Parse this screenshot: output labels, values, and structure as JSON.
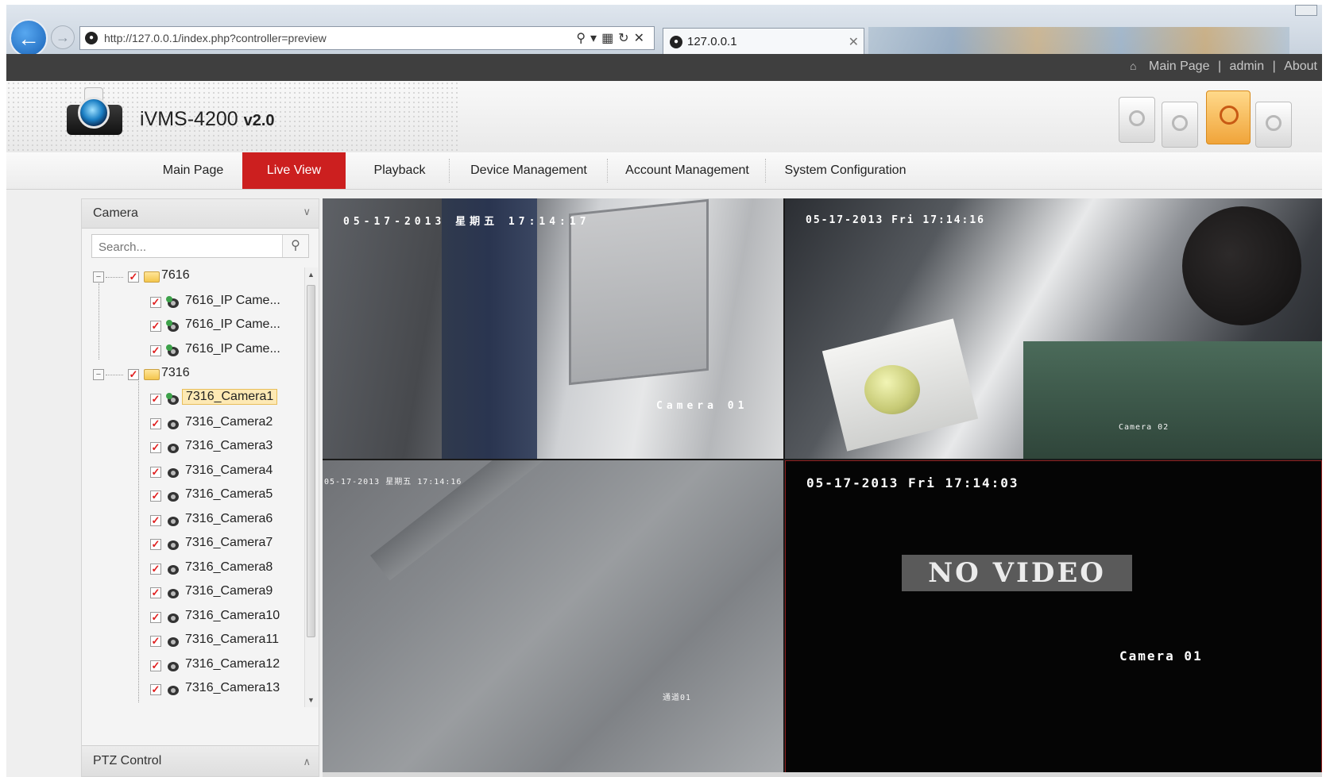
{
  "browser": {
    "url": "http://127.0.0.1/index.php?controller=preview",
    "url_host_prefix": "http://",
    "tab_title": "127.0.0.1"
  },
  "top_links": {
    "main_page": "Main Page",
    "sep1": "|",
    "user": "admin",
    "sep2": "|",
    "about": "About"
  },
  "app": {
    "name": "iVMS-4200",
    "version": "v2.0"
  },
  "nav": {
    "items": [
      "Main Page",
      "Live View",
      "Playback",
      "Device Management",
      "Account Management",
      "System Configuration"
    ],
    "active": "Live View"
  },
  "camera_panel": {
    "title": "Camera",
    "search_placeholder": "Search...",
    "groups": [
      {
        "name": "7616",
        "cameras": [
          "7616_IP Came...",
          "7616_IP Came...",
          "7616_IP Came..."
        ]
      },
      {
        "name": "7316",
        "cameras": [
          "7316_Camera1",
          "7316_Camera2",
          "7316_Camera3",
          "7316_Camera4",
          "7316_Camera5",
          "7316_Camera6",
          "7316_Camera7",
          "7316_Camera8",
          "7316_Camera9",
          "7316_Camera10",
          "7316_Camera11",
          "7316_Camera12",
          "7316_Camera13"
        ]
      }
    ],
    "selected_camera": "7316_Camera1"
  },
  "ptz_panel": {
    "title": "PTZ Control"
  },
  "video_tiles": [
    {
      "timestamp": "05-17-2013 星期五 17:14:17",
      "camera_label": "Camera 01"
    },
    {
      "timestamp": "05-17-2013 Fri 17:14:16",
      "camera_label": "Camera 02"
    },
    {
      "timestamp": "05-17-2013 星期五 17:14:16",
      "camera_label": "通道01"
    },
    {
      "timestamp": "05-17-2013 Fri 17:14:03",
      "camera_label": "Camera 01",
      "status": "NO VIDEO"
    }
  ],
  "colors": {
    "accent": "#cc1f1f",
    "top_bar": "#3f3f3f",
    "selection": "#fde9b4"
  }
}
